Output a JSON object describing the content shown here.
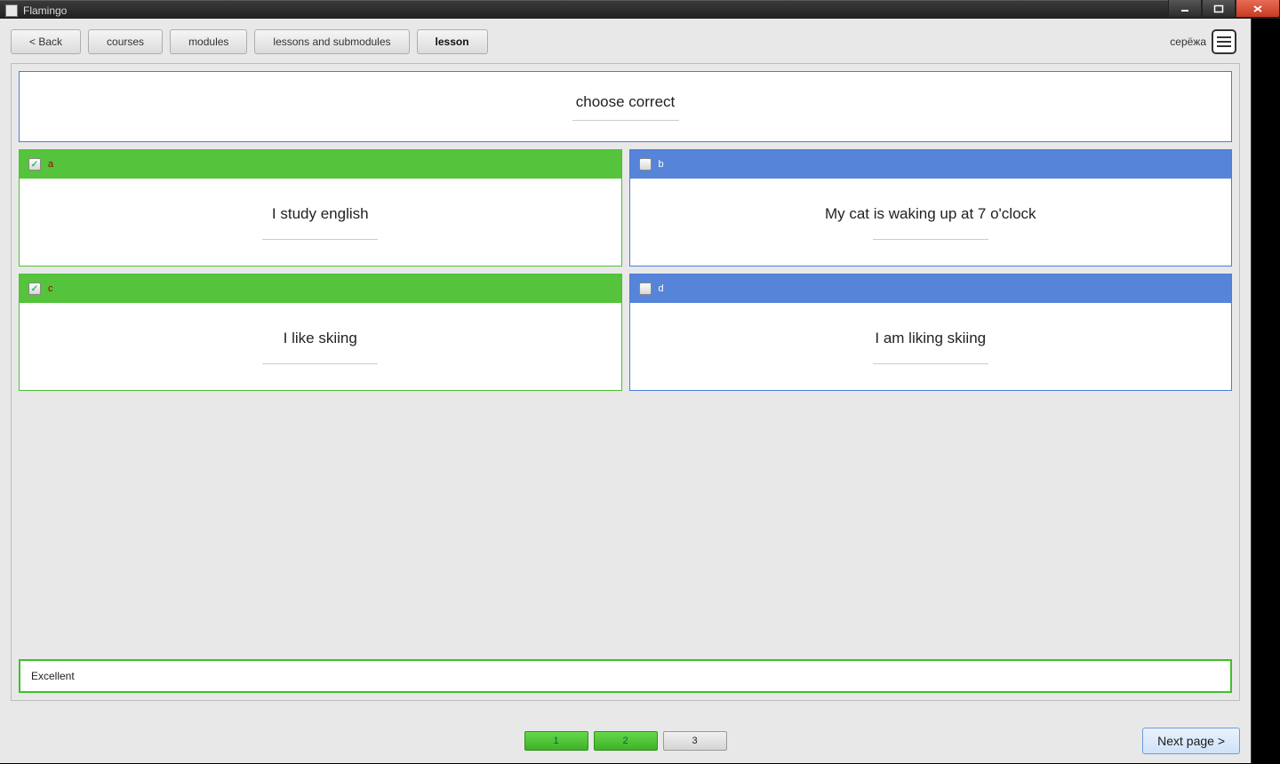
{
  "window": {
    "title": "Flamingo"
  },
  "toolbar": {
    "back": "< Back",
    "courses": "courses",
    "modules": "modules",
    "lessons_submodules": "lessons and submodules",
    "lesson": "lesson"
  },
  "user": {
    "name": "серёжа"
  },
  "lesson": {
    "prompt": "choose correct",
    "answers": [
      {
        "letter": "a",
        "text": "I study english",
        "checked": true,
        "correct": true
      },
      {
        "letter": "b",
        "text": "My cat is waking up at 7 o'clock",
        "checked": false,
        "correct": false
      },
      {
        "letter": "c",
        "text": "I like skiing",
        "checked": true,
        "correct": true
      },
      {
        "letter": "d",
        "text": "I am liking skiing",
        "checked": false,
        "correct": false
      }
    ],
    "feedback": "Excellent"
  },
  "pager": {
    "pages": [
      {
        "num": "1",
        "done": true
      },
      {
        "num": "2",
        "done": true
      },
      {
        "num": "3",
        "done": false
      }
    ],
    "next": "Next page >"
  }
}
